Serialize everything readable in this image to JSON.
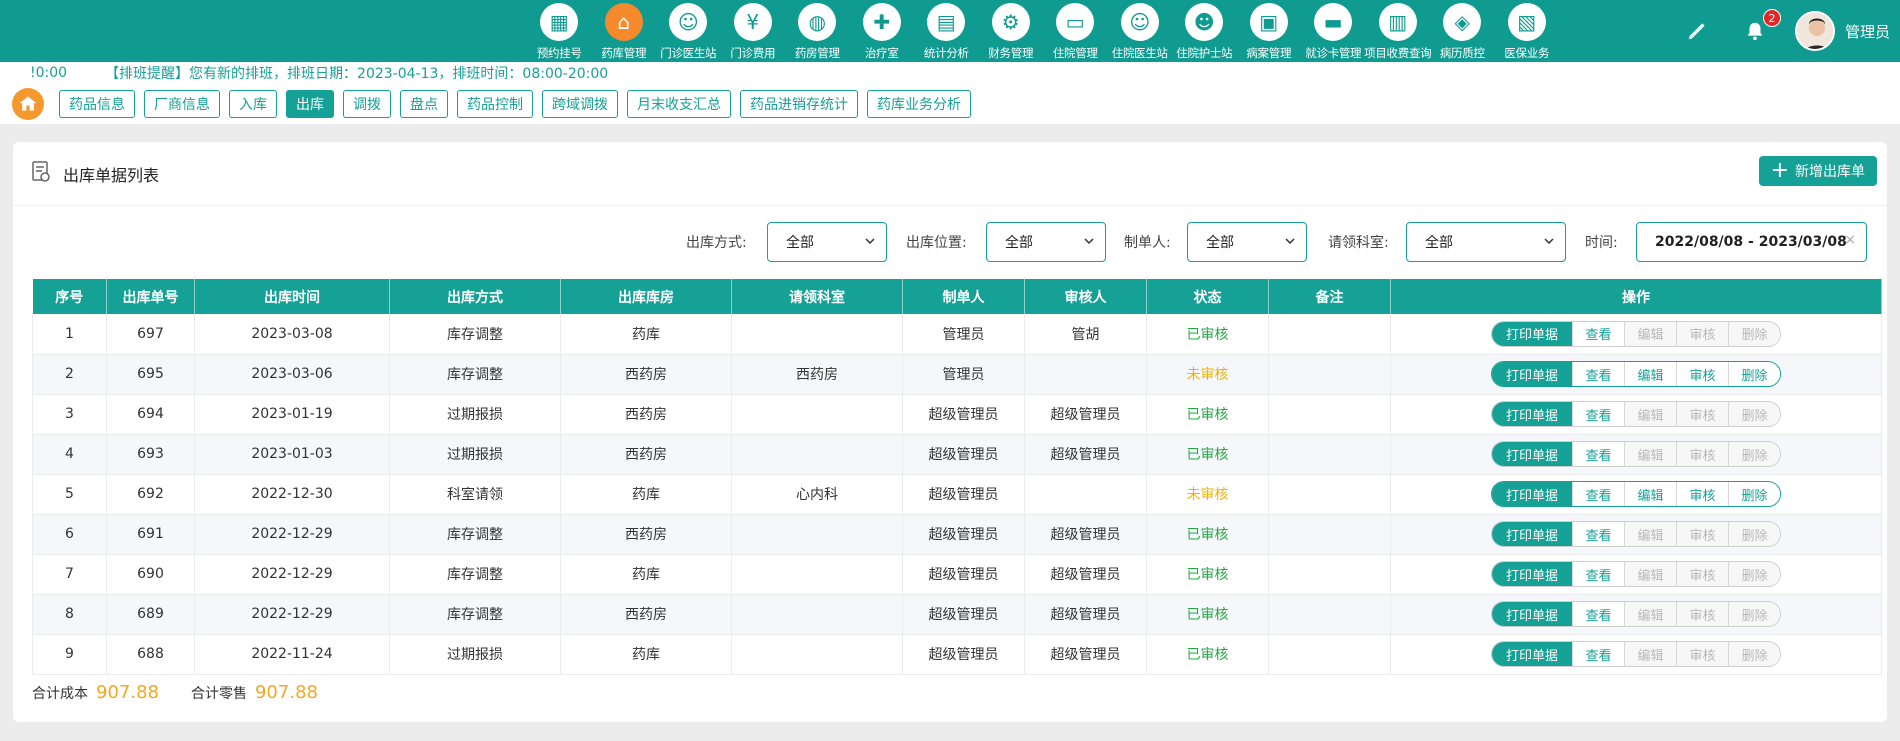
{
  "nav": {
    "items": [
      {
        "label": "预约挂号",
        "icon": "calendar-icon",
        "active": false
      },
      {
        "label": "药库管理",
        "icon": "house-icon",
        "active": true
      },
      {
        "label": "门诊医生站",
        "icon": "doctor-icon",
        "active": false
      },
      {
        "label": "门诊费用",
        "icon": "yen-icon",
        "active": false
      },
      {
        "label": "药房管理",
        "icon": "pill-icon",
        "active": false
      },
      {
        "label": "治疗室",
        "icon": "nurse-icon",
        "active": false
      },
      {
        "label": "统计分析",
        "icon": "chart-icon",
        "active": false
      },
      {
        "label": "财务管理",
        "icon": "gear-icon",
        "active": false
      },
      {
        "label": "住院管理",
        "icon": "bed-icon",
        "active": false
      },
      {
        "label": "住院医生站",
        "icon": "doctor-card-icon",
        "active": false
      },
      {
        "label": "住院护士站",
        "icon": "nurse-card-icon",
        "active": false
      },
      {
        "label": "病案管理",
        "icon": "record-icon",
        "active": false
      },
      {
        "label": "就诊卡管理",
        "icon": "card-icon",
        "active": false
      },
      {
        "label": "项目收费查询",
        "icon": "invoice-icon",
        "active": false
      },
      {
        "label": "病历质控",
        "icon": "quality-icon",
        "active": false
      },
      {
        "label": "医保业务",
        "icon": "insurance-icon",
        "active": false
      }
    ],
    "notifications": "2",
    "user": "管理员"
  },
  "notice": {
    "time": "!0:00",
    "message": "【排班提醒】您有新的排班，排班日期：2023-04-13，排班时间：08:00-20:00"
  },
  "subtabs": [
    {
      "label": "药品信息",
      "active": false
    },
    {
      "label": "厂商信息",
      "active": false
    },
    {
      "label": "入库",
      "active": false
    },
    {
      "label": "出库",
      "active": true
    },
    {
      "label": "调拨",
      "active": false
    },
    {
      "label": "盘点",
      "active": false
    },
    {
      "label": "药品控制",
      "active": false
    },
    {
      "label": "跨域调拨",
      "active": false
    },
    {
      "label": "月末收支汇总",
      "active": false
    },
    {
      "label": "药品进销存统计",
      "active": false
    },
    {
      "label": "药库业务分析",
      "active": false
    }
  ],
  "card": {
    "title": "出库单据列表",
    "add_button": "新增出库单"
  },
  "filters": {
    "method_label": "出库方式:",
    "method_value": "全部",
    "location_label": "出库位置:",
    "location_value": "全部",
    "creator_label": "制单人:",
    "creator_value": "全部",
    "dept_label": "请领科室:",
    "dept_value": "全部",
    "time_label": "时间:",
    "time_value": "2022/08/08 - 2023/03/08"
  },
  "table": {
    "headers": [
      "序号",
      "出库单号",
      "出库时间",
      "出库方式",
      "出库库房",
      "请领科室",
      "制单人",
      "审核人",
      "状态",
      "备注",
      "操作"
    ],
    "actions": {
      "print": "打印单据",
      "view": "查看",
      "edit": "编辑",
      "audit": "审核",
      "delete": "删除"
    },
    "rows": [
      {
        "idx": "1",
        "no": "697",
        "time": "2023-03-08",
        "method": "库存调整",
        "store": "药库",
        "dept": "",
        "creator": "管理员",
        "auditor": "管胡",
        "status": "已审核",
        "note": "",
        "audited": true
      },
      {
        "idx": "2",
        "no": "695",
        "time": "2023-03-06",
        "method": "库存调整",
        "store": "西药房",
        "dept": "西药房",
        "creator": "管理员",
        "auditor": "",
        "status": "未审核",
        "note": "",
        "audited": false
      },
      {
        "idx": "3",
        "no": "694",
        "time": "2023-01-19",
        "method": "过期报损",
        "store": "西药房",
        "dept": "",
        "creator": "超级管理员",
        "auditor": "超级管理员",
        "status": "已审核",
        "note": "",
        "audited": true
      },
      {
        "idx": "4",
        "no": "693",
        "time": "2023-01-03",
        "method": "过期报损",
        "store": "西药房",
        "dept": "",
        "creator": "超级管理员",
        "auditor": "超级管理员",
        "status": "已审核",
        "note": "",
        "audited": true
      },
      {
        "idx": "5",
        "no": "692",
        "time": "2022-12-30",
        "method": "科室请领",
        "store": "药库",
        "dept": "心内科",
        "creator": "超级管理员",
        "auditor": "",
        "status": "未审核",
        "note": "",
        "audited": false
      },
      {
        "idx": "6",
        "no": "691",
        "time": "2022-12-29",
        "method": "库存调整",
        "store": "西药房",
        "dept": "",
        "creator": "超级管理员",
        "auditor": "超级管理员",
        "status": "已审核",
        "note": "",
        "audited": true
      },
      {
        "idx": "7",
        "no": "690",
        "time": "2022-12-29",
        "method": "库存调整",
        "store": "药库",
        "dept": "",
        "creator": "超级管理员",
        "auditor": "超级管理员",
        "status": "已审核",
        "note": "",
        "audited": true
      },
      {
        "idx": "8",
        "no": "689",
        "time": "2022-12-29",
        "method": "库存调整",
        "store": "西药房",
        "dept": "",
        "creator": "超级管理员",
        "auditor": "超级管理员",
        "status": "已审核",
        "note": "",
        "audited": true
      },
      {
        "idx": "9",
        "no": "688",
        "time": "2022-11-24",
        "method": "过期报损",
        "store": "药库",
        "dept": "",
        "creator": "超级管理员",
        "auditor": "超级管理员",
        "status": "已审核",
        "note": "",
        "audited": true
      }
    ]
  },
  "totals": {
    "cost_label": "合计成本",
    "cost_value": "907.88",
    "retail_label": "合计零售",
    "retail_value": "907.88"
  },
  "colors": {
    "primary": "#16a196",
    "nav_bg": "#0f9b90",
    "accent_orange": "#f58a2c",
    "status_ok": "#28a745",
    "status_pending": "#f0b400",
    "total_value": "#f5a623"
  }
}
